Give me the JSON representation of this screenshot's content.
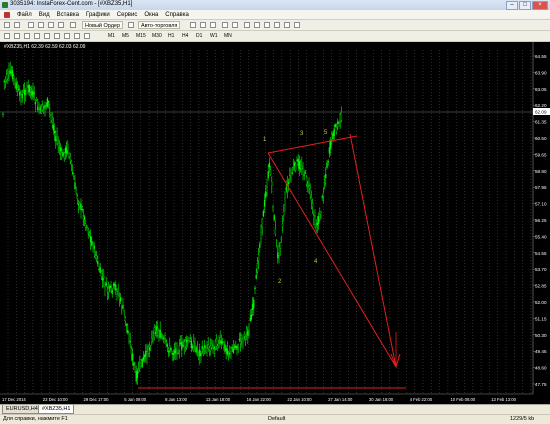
{
  "window": {
    "title": "3035194: InstaForex-Cent.com - [#XBZ35,H1]"
  },
  "menu": [
    "Файл",
    "Вид",
    "Вставка",
    "Графики",
    "Сервис",
    "Окна",
    "Справка"
  ],
  "toolbar": {
    "new_order": "Новый Ордер",
    "auto_trading": "Авто-торговля"
  },
  "timeframes": [
    "M1",
    "M5",
    "M15",
    "M30",
    "H1",
    "H4",
    "D1",
    "W1",
    "MN"
  ],
  "chart": {
    "header": "#XBZ35,H1  62.39 62.59 62.03 62.09",
    "price_labels": [
      "64.55",
      "63.90",
      "63.05",
      "62.20",
      "61.35",
      "60.50",
      "59.65",
      "58.80",
      "57.95",
      "57.10",
      "56.25",
      "55.40",
      "54.55",
      "53.70",
      "52.85",
      "52.00",
      "51.15",
      "50.30",
      "49.45",
      "48.60",
      "47.75"
    ],
    "current_price": "62.09",
    "time_labels": [
      "17 Dec 2014",
      "23 Dec 10:00",
      "29 Dec 17:00",
      "5 Jan 09:00",
      "8 Jan 13:00",
      "13 Jan 18:00",
      "16 Jan 22:00",
      "22 Jan 10:00",
      "27 Jan 14:00",
      "30 Jan 18:00",
      "4 Feb 22:00",
      "10 Feb 06:00",
      "13 Feb 13:00"
    ],
    "wave_labels": [
      "1",
      "2",
      "3",
      "4",
      "5"
    ],
    "colors": {
      "candles": "#00ff00",
      "background": "#000000",
      "trend_lines": "#e02020",
      "wave_label": "#c9c94a"
    }
  },
  "tabs": [
    "EURUSD,H4",
    "#XBZ35,H1"
  ],
  "status": {
    "help": "Для справки, нажмите F1",
    "profile": "Default",
    "traffic": "1229/5 kb"
  },
  "icons": [
    "app-icon",
    "minimize-icon",
    "maximize-icon",
    "close-icon",
    "crosshair-icon",
    "line-icon",
    "zoom-in-icon",
    "zoom-out-icon"
  ]
}
